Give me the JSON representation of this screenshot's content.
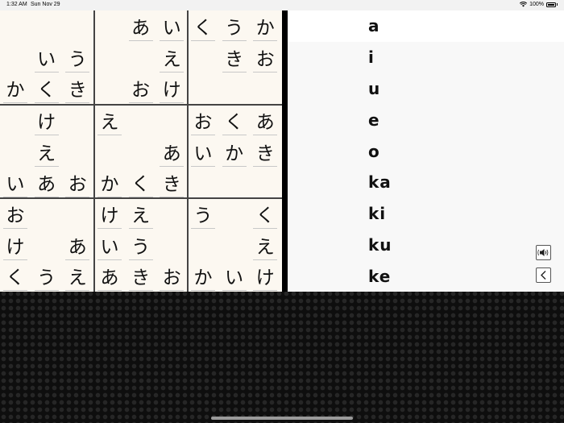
{
  "status_bar": {
    "time": "1:32 AM",
    "date": "Sun Nov 29",
    "battery": "100%"
  },
  "grid": [
    [
      "",
      "",
      "",
      "",
      "あ",
      "い",
      "く",
      "う",
      "か"
    ],
    [
      "",
      "い",
      "う",
      "",
      "",
      "え",
      "",
      "き",
      "お"
    ],
    [
      "か",
      "く",
      "き",
      "",
      "お",
      "け",
      "",
      "",
      ""
    ],
    [
      "",
      "け",
      "",
      "え",
      "",
      "",
      "お",
      "く",
      "あ"
    ],
    [
      "",
      "え",
      "",
      "",
      "",
      "あ",
      "い",
      "か",
      "き"
    ],
    [
      "い",
      "あ",
      "お",
      "か",
      "く",
      "き",
      "",
      "",
      ""
    ],
    [
      "お",
      "",
      "",
      "け",
      "え",
      "",
      "う",
      "",
      "く"
    ],
    [
      "け",
      "",
      "あ",
      "い",
      "う",
      "",
      "",
      "",
      "え"
    ],
    [
      "く",
      "う",
      "え",
      "あ",
      "き",
      "お",
      "か",
      "い",
      "け"
    ]
  ],
  "answers": [
    "a",
    "i",
    "u",
    "e",
    "o",
    "ka",
    "ki",
    "ku",
    "ke"
  ],
  "selected_answer_index": 0,
  "icons": {
    "sound": "speaker-icon",
    "back": "chevron-left-icon"
  },
  "colors": {
    "board_bg": "#fcf8f1",
    "panel_bg": "#f8f8f8",
    "selected_row_bg": "#ffffff",
    "grid_line": "#444444"
  }
}
